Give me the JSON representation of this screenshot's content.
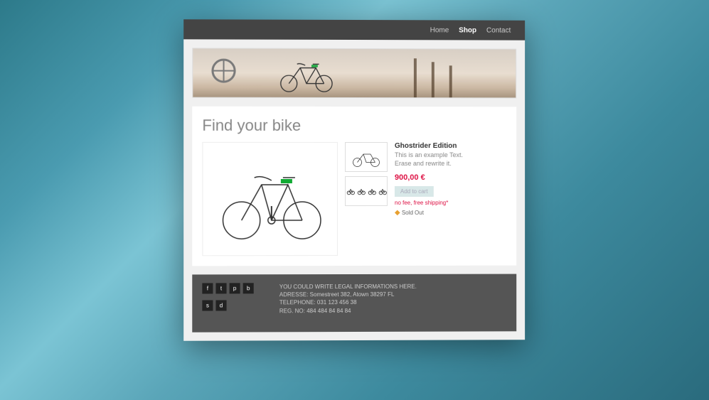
{
  "nav": {
    "home": "Home",
    "shop": "Shop",
    "contact": "Contact",
    "active": "shop"
  },
  "heading": "Find your bike",
  "product": {
    "name": "Ghostrider Edition",
    "desc_line1": "This is an example Text.",
    "desc_line2": "Erase and rewrite it.",
    "price": "900,00 €",
    "button": "Add to cart",
    "note": "no fee, free shipping*",
    "stock": "Sold Out"
  },
  "footer": {
    "line1": "YOU COULD WRITE LEGAL INFORMATIONS HERE.",
    "line2": "ADRESSE: Somestreet 382, Atown 38297 FL",
    "line3": "TELEPHONE: 031 123 456 38",
    "line4": "REG. NO: 484 484 84 84 84"
  },
  "socials": [
    "f",
    "t",
    "p",
    "b",
    "s",
    "d"
  ]
}
